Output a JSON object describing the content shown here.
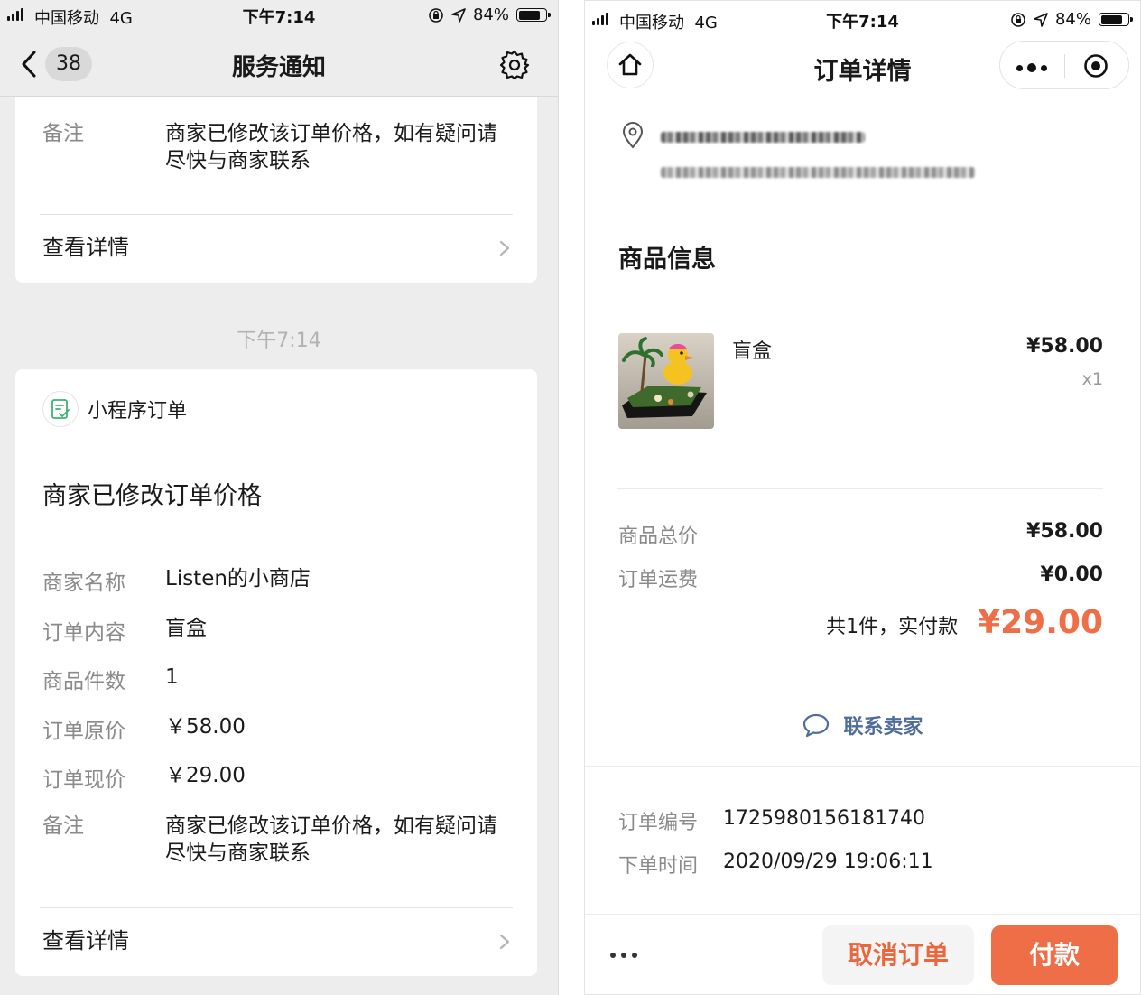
{
  "left": {
    "status": {
      "carrier": "中国移动",
      "network": "4G",
      "time": "下午7:14",
      "battery": "84%",
      "battery_level": 0.84
    },
    "nav": {
      "back_count": "38",
      "title": "服务通知"
    },
    "card_top": {
      "remark_label": "备注",
      "remark_value": "商家已修改该订单价格，如有疑问请尽快与商家联系",
      "detail_link": "查看详情"
    },
    "timestamp": "下午7:14",
    "card_main": {
      "source": "小程序订单",
      "heading": "商家已修改订单价格",
      "rows": [
        {
          "label": "商家名称",
          "value": "Listen的小商店"
        },
        {
          "label": "订单内容",
          "value": "盲盒"
        },
        {
          "label": "商品件数",
          "value": "1"
        },
        {
          "label": "订单原价",
          "value": "￥58.00"
        },
        {
          "label": "订单现价",
          "value": "￥29.00"
        }
      ],
      "remark_label": "备注",
      "remark_value": "商家已修改该订单价格，如有疑问请尽快与商家联系",
      "detail_link": "查看详情"
    }
  },
  "right": {
    "status": {
      "carrier": "中国移动",
      "network": "4G",
      "time": "下午7:14",
      "battery": "84%",
      "battery_level": 0.84
    },
    "nav": {
      "title": "订单详情"
    },
    "section_title": "商品信息",
    "product": {
      "name": "盲盒",
      "price": "¥58.00",
      "qty": "x1"
    },
    "summary": {
      "total_label": "商品总价",
      "total_value": "¥58.00",
      "shipping_label": "订单运费",
      "shipping_value": "¥0.00",
      "paid_label": "共1件，实付款",
      "paid_value": "¥29.00"
    },
    "contact": "联系卖家",
    "order": {
      "number_label": "订单编号",
      "number_value": "1725980156181740",
      "time_label": "下单时间",
      "time_value": "2020/09/29 19:06:11"
    },
    "actions": {
      "cancel": "取消订单",
      "pay": "付款"
    },
    "accent_color": "#ee6f47"
  }
}
